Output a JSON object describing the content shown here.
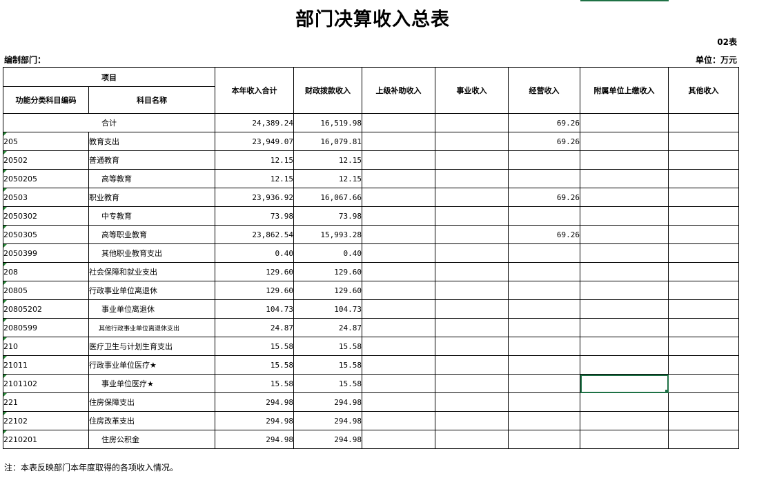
{
  "header": {
    "title": "部门决算收入总表",
    "table_no": "02表",
    "dept_label": "编制部门：",
    "unit_label": "单位：万元"
  },
  "columns": {
    "item": "项目",
    "code": "功能分类科目编码",
    "name": "科目名称",
    "total": "本年收入合计",
    "fiscal": "财政拨款收入",
    "upper": "上级补助收入",
    "career": "事业收入",
    "operating": "经营收入",
    "affiliated": "附属单位上缴收入",
    "other": "其他收入"
  },
  "total_row": {
    "label": "合计",
    "total": "24,389.24",
    "fiscal": "16,519.98",
    "upper": "",
    "career": "",
    "operating": "69.26",
    "affiliated": "",
    "other": ""
  },
  "rows": [
    {
      "code": "205",
      "name": "教育支出",
      "total": "23,949.07",
      "fiscal": "16,079.81",
      "upper": "",
      "career": "",
      "operating": "69.26",
      "affiliated": "",
      "other": ""
    },
    {
      "code": "20502",
      "name": "普通教育",
      "total": "12.15",
      "fiscal": "12.15",
      "upper": "",
      "career": "",
      "operating": "",
      "affiliated": "",
      "other": ""
    },
    {
      "code": "2050205",
      "name": "高等教育",
      "total": "12.15",
      "fiscal": "12.15",
      "upper": "",
      "career": "",
      "operating": "",
      "affiliated": "",
      "other": ""
    },
    {
      "code": "20503",
      "name": "职业教育",
      "total": "23,936.92",
      "fiscal": "16,067.66",
      "upper": "",
      "career": "",
      "operating": "69.26",
      "affiliated": "",
      "other": ""
    },
    {
      "code": "2050302",
      "name": "中专教育",
      "total": "73.98",
      "fiscal": "73.98",
      "upper": "",
      "career": "",
      "operating": "",
      "affiliated": "",
      "other": ""
    },
    {
      "code": "2050305",
      "name": "高等职业教育",
      "total": "23,862.54",
      "fiscal": "15,993.28",
      "upper": "",
      "career": "",
      "operating": "69.26",
      "affiliated": "",
      "other": ""
    },
    {
      "code": "2050399",
      "name": "其他职业教育支出",
      "total": "0.40",
      "fiscal": "0.40",
      "upper": "",
      "career": "",
      "operating": "",
      "affiliated": "",
      "other": ""
    },
    {
      "code": "208",
      "name": "社会保障和就业支出",
      "total": "129.60",
      "fiscal": "129.60",
      "upper": "",
      "career": "",
      "operating": "",
      "affiliated": "",
      "other": ""
    },
    {
      "code": "20805",
      "name": "行政事业单位离退休",
      "total": "129.60",
      "fiscal": "129.60",
      "upper": "",
      "career": "",
      "operating": "",
      "affiliated": "",
      "other": ""
    },
    {
      "code": "20805202",
      "name": "事业单位离退休",
      "total": "104.73",
      "fiscal": "104.73",
      "upper": "",
      "career": "",
      "operating": "",
      "affiliated": "",
      "other": ""
    },
    {
      "code": "2080599",
      "name": "其他行政事业单位离退休支出",
      "total": "24.87",
      "fiscal": "24.87",
      "upper": "",
      "career": "",
      "operating": "",
      "affiliated": "",
      "other": ""
    },
    {
      "code": "210",
      "name": "医疗卫生与计划生育支出",
      "total": "15.58",
      "fiscal": "15.58",
      "upper": "",
      "career": "",
      "operating": "",
      "affiliated": "",
      "other": ""
    },
    {
      "code": "21011",
      "name": "行政事业单位医疗★",
      "total": "15.58",
      "fiscal": "15.58",
      "upper": "",
      "career": "",
      "operating": "",
      "affiliated": "",
      "other": ""
    },
    {
      "code": "2101102",
      "name": "事业单位医疗★",
      "total": "15.58",
      "fiscal": "15.58",
      "upper": "",
      "career": "",
      "operating": "",
      "affiliated": "",
      "other": ""
    },
    {
      "code": "221",
      "name": "住房保障支出",
      "total": "294.98",
      "fiscal": "294.98",
      "upper": "",
      "career": "",
      "operating": "",
      "affiliated": "",
      "other": ""
    },
    {
      "code": "22102",
      "name": "住房改革支出",
      "total": "294.98",
      "fiscal": "294.98",
      "upper": "",
      "career": "",
      "operating": "",
      "affiliated": "",
      "other": ""
    },
    {
      "code": "2210201",
      "name": "住房公积金",
      "total": "294.98",
      "fiscal": "294.98",
      "upper": "",
      "career": "",
      "operating": "",
      "affiliated": "",
      "other": ""
    }
  ],
  "note": "注：本表反映部门本年度取得的各项收入情况。",
  "colors": {
    "selection": "#1e7145",
    "cell_marker": "#2a8a3a"
  }
}
